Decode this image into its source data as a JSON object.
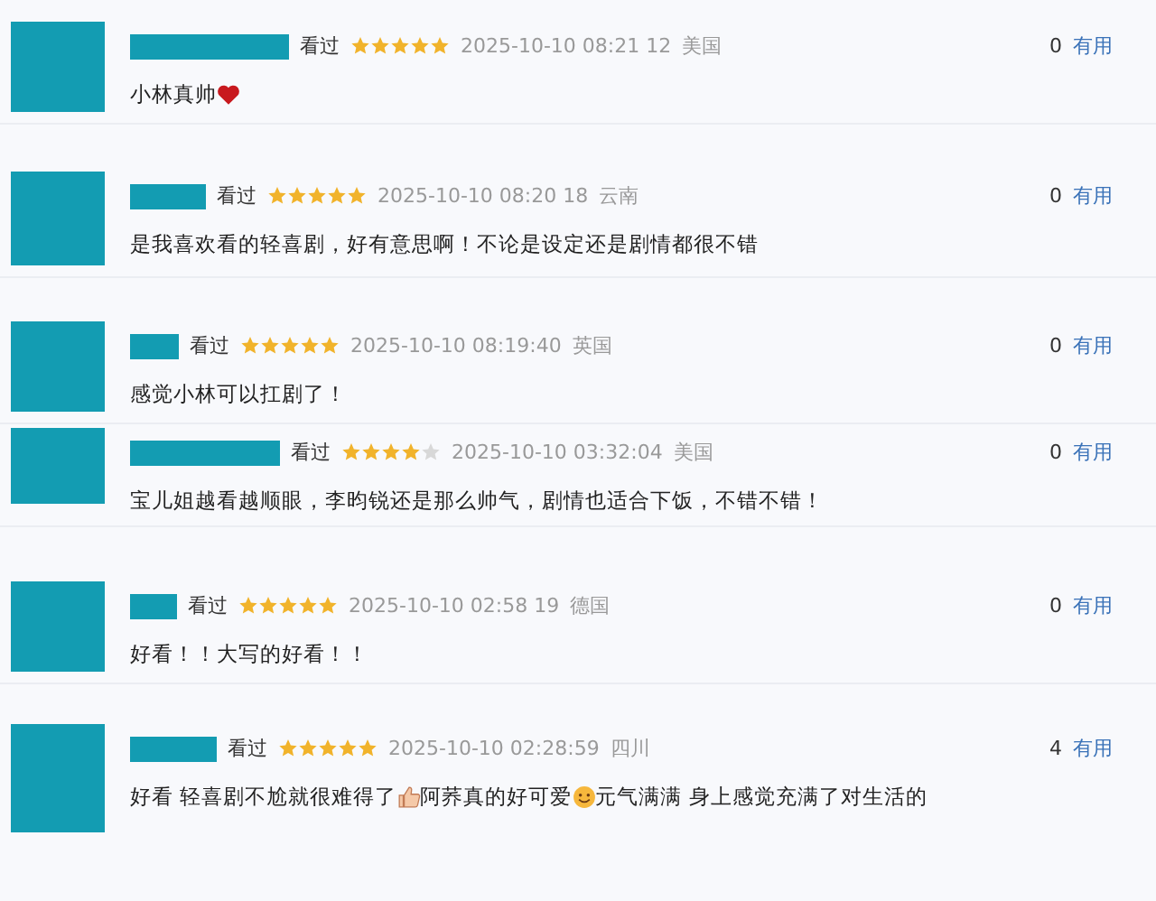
{
  "comments": [
    {
      "watched": "看过",
      "stars": 5,
      "time": "2025-10-10 08:21 12",
      "location": "美国",
      "count": "0",
      "useful": "有用",
      "content": [
        {
          "kind": "text",
          "text": "小林真帅"
        },
        {
          "kind": "heart"
        }
      ]
    },
    {
      "watched": "看过",
      "stars": 5,
      "time": "2025-10-10 08:20 18",
      "location": "云南",
      "count": "0",
      "useful": "有用",
      "content": [
        {
          "kind": "text",
          "text": "是我喜欢看的轻喜剧，好有意思啊！不论是设定还是剧情都很不错"
        }
      ]
    },
    {
      "watched": "看过",
      "stars": 5,
      "time": "2025-10-10 08:19:40",
      "location": "英国",
      "count": "0",
      "useful": "有用",
      "content": [
        {
          "kind": "text",
          "text": "感觉小林可以扛剧了！"
        }
      ]
    },
    {
      "watched": "看过",
      "stars": 4,
      "time": "2025-10-10 03:32:04",
      "location": "美国",
      "count": "0",
      "useful": "有用",
      "content": [
        {
          "kind": "text",
          "text": "宝儿姐越看越顺眼，李昀锐还是那么帅气，剧情也适合下饭，不错不错！"
        }
      ]
    },
    {
      "watched": "看过",
      "stars": 5,
      "time": "2025-10-10 02:58 19",
      "location": "德国",
      "count": "0",
      "useful": "有用",
      "content": [
        {
          "kind": "text",
          "text": "好看！！大写的好看！！"
        }
      ]
    },
    {
      "watched": "看过",
      "stars": 5,
      "time": "2025-10-10 02:28:59",
      "location": "四川",
      "count": "4",
      "useful": "有用",
      "content": [
        {
          "kind": "text",
          "text": "好看 轻喜剧不尬就很难得了"
        },
        {
          "kind": "thumb"
        },
        {
          "kind": "text",
          "text": "阿荞真的好可爱"
        },
        {
          "kind": "smile"
        },
        {
          "kind": "text",
          "text": "元气满满 身上感觉充满了对生活的"
        }
      ]
    }
  ]
}
